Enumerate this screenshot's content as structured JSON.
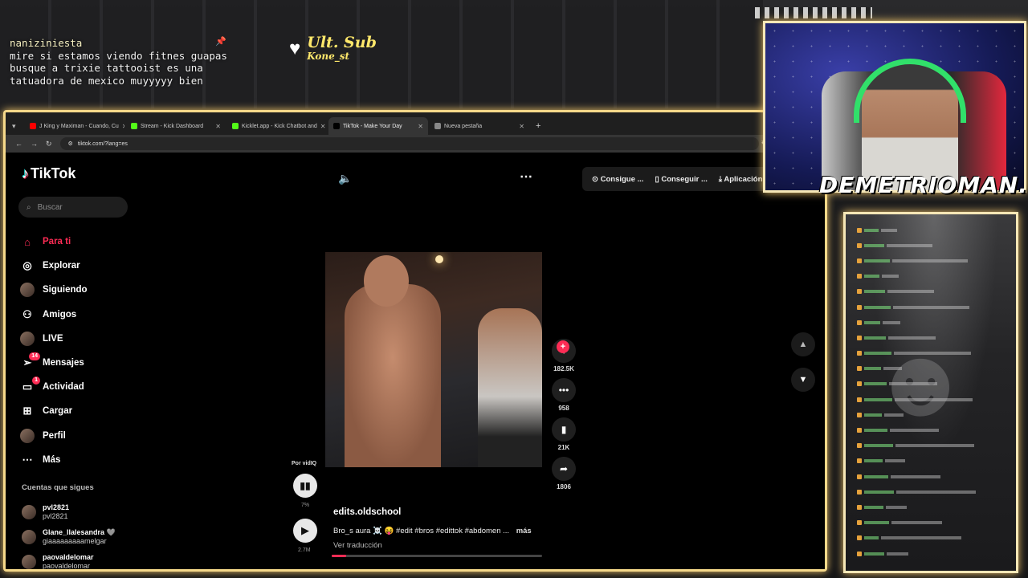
{
  "overlay": {
    "chat_user": "naniziniesta",
    "chat_lines": [
      "mire si estamos viendo fitnes guapas",
      "busque a trixie tattooist es una",
      "tatuadora de mexico muyyyyy bien"
    ],
    "ult_sub_title": "Ult. Sub",
    "ult_sub_name": "Kone_st",
    "streamer_name": "DEMETRIOMAN...."
  },
  "browser": {
    "tabs": [
      {
        "label": "J King y Maximan - Cuando, Cu",
        "color": "#ff0000",
        "active": false
      },
      {
        "label": "Stream - Kick Dashboard",
        "color": "#53fc18",
        "active": false
      },
      {
        "label": "Kicklet.app - Kick Chatbot and",
        "color": "#53fc18",
        "active": false
      },
      {
        "label": "TikTok - Make Your Day",
        "color": "#000000",
        "active": true
      },
      {
        "label": "Nueva pestaña",
        "color": "#888888",
        "active": false
      }
    ],
    "url": "tiktok.com/?lang=es"
  },
  "tiktok": {
    "logo": "TikTok",
    "search_placeholder": "Buscar",
    "nav": [
      {
        "label": "Para ti",
        "icon": "home-icon",
        "active": true,
        "badge": ""
      },
      {
        "label": "Explorar",
        "icon": "compass-icon",
        "active": false,
        "badge": ""
      },
      {
        "label": "Siguiendo",
        "icon": "following-avatar-icon",
        "active": false,
        "badge": ""
      },
      {
        "label": "Amigos",
        "icon": "friends-icon",
        "active": false,
        "badge": ""
      },
      {
        "label": "LIVE",
        "icon": "live-avatar-icon",
        "active": false,
        "badge": ""
      },
      {
        "label": "Mensajes",
        "icon": "messages-icon",
        "active": false,
        "badge": "14"
      },
      {
        "label": "Actividad",
        "icon": "activity-icon",
        "active": false,
        "badge": "1"
      },
      {
        "label": "Cargar",
        "icon": "upload-icon",
        "active": false,
        "badge": ""
      },
      {
        "label": "Perfil",
        "icon": "profile-avatar-icon",
        "active": false,
        "badge": ""
      },
      {
        "label": "Más",
        "icon": "more-icon",
        "active": false,
        "badge": ""
      }
    ],
    "following_title": "Cuentas que sigues",
    "following": [
      {
        "user": "pvl2821",
        "sub": "pvl2821"
      },
      {
        "user": "Glane_llalesandra 🩶",
        "sub": "giaaaaaaaaamelgar"
      },
      {
        "user": "paovaldelomar",
        "sub": "paovaldelomar"
      }
    ],
    "top_buttons": [
      "Consigue ...",
      "Conseguir ...",
      "Aplicación"
    ],
    "video": {
      "author": "edits.oldschool",
      "description": "Bro_s aura ☠️ 😝 #edit #bros #edittok #abdomen ...",
      "more": "más",
      "translate": "Ver traducción",
      "progress": 0.07
    },
    "actions": [
      {
        "name": "like",
        "icon": "♥",
        "count": "182.5K"
      },
      {
        "name": "comment",
        "icon": "•••",
        "count": "958"
      },
      {
        "name": "save",
        "icon": "▮",
        "count": "21K"
      },
      {
        "name": "share",
        "icon": "➦",
        "count": "1806"
      }
    ],
    "vidiq": {
      "label": "Por vidIQ",
      "percent": "7%",
      "views": "2.7M"
    }
  }
}
